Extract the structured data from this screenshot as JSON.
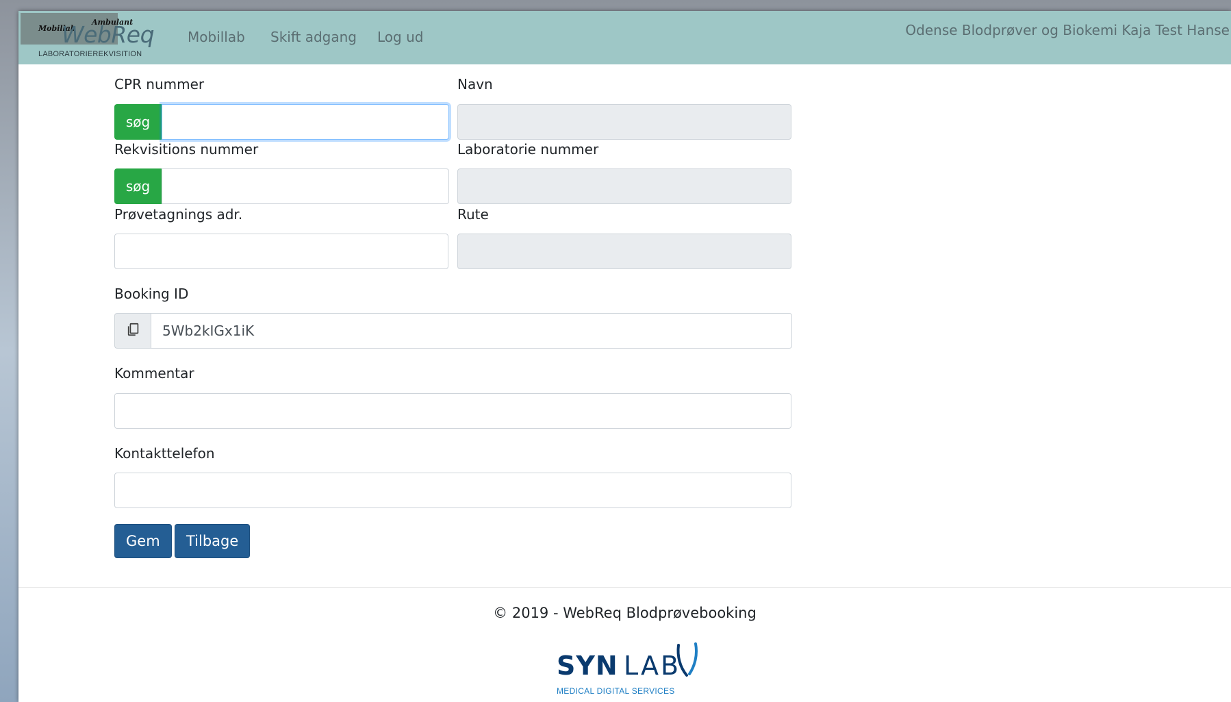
{
  "header": {
    "logo": {
      "title": "WebReq",
      "subtitle": "LABORATORIEREKVISITION",
      "tag_left": "Mobillab",
      "tag_right": "Ambulant"
    },
    "nav": [
      {
        "label": "Mobillab"
      },
      {
        "label": "Skift adgang"
      },
      {
        "label": "Log ud"
      }
    ],
    "user_info": "Odense Blodprøver og Biokemi Kaja Test Hanse"
  },
  "form": {
    "cpr": {
      "label": "CPR nummer",
      "value": "",
      "button": "søg"
    },
    "navn": {
      "label": "Navn",
      "value": ""
    },
    "rekvisition": {
      "label": "Rekvisitions nummer",
      "value": "",
      "button": "søg"
    },
    "laboratorie": {
      "label": "Laboratorie nummer",
      "value": ""
    },
    "provetagning": {
      "label": "Prøvetagnings adr.",
      "value": ""
    },
    "rute": {
      "label": "Rute",
      "value": ""
    },
    "booking": {
      "label": "Booking ID",
      "value": "5Wb2kIGx1iK"
    },
    "kommentar": {
      "label": "Kommentar",
      "value": ""
    },
    "kontakt": {
      "label": "Kontakttelefon",
      "value": ""
    },
    "buttons": {
      "save": "Gem",
      "back": "Tilbage"
    }
  },
  "footer": {
    "copyright": "© 2019 - WebReq Blodprøvebooking",
    "brand": {
      "name_bold": "SYN",
      "name_light": "LAB",
      "sub": "MEDICAL DIGITAL SERVICES"
    }
  },
  "colors": {
    "navbar": "#9ec7c6",
    "search_button": "#28a745",
    "primary_button": "#245e94",
    "readonly_field": "#e9ecef",
    "brand_navy": "#0a3a6e",
    "brand_blue": "#1f7fc4"
  },
  "icons": {
    "copy": "copy-icon"
  }
}
